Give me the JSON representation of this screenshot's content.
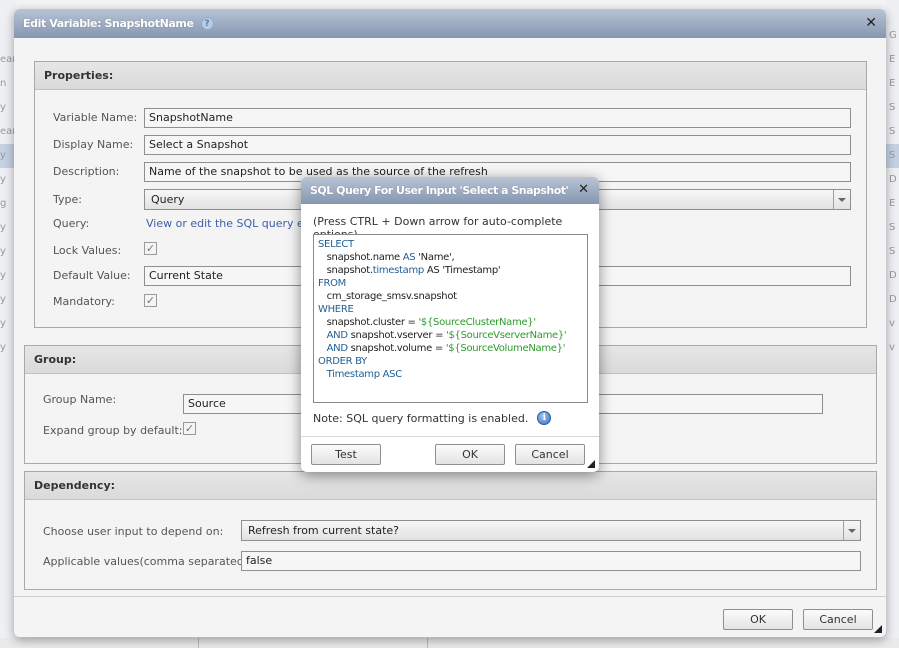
{
  "background": {
    "left_rows": [
      "ean",
      "n",
      "y",
      "ean",
      "y",
      "y",
      "g",
      "y",
      "y",
      "y",
      "y",
      "y",
      "y"
    ],
    "left_selected_index": 4,
    "right_rows": [
      "G",
      "E",
      "E",
      "S",
      "S",
      "S",
      "D",
      "E",
      "S",
      "S",
      "D",
      "D",
      "v",
      "v"
    ],
    "right_selected_index": 5
  },
  "dialog": {
    "title": "Edit Variable: SnapshotName",
    "help_glyph": "?",
    "close_glyph": "✕",
    "properties": {
      "heading": "Properties:",
      "variable_name_label": "Variable Name:",
      "variable_name_value": "SnapshotName",
      "display_name_label": "Display Name:",
      "display_name_value": "Select a Snapshot",
      "description_label": "Description:",
      "description_value": "Name of the snapshot to be used as the source of the refresh",
      "type_label": "Type:",
      "type_value": "Query",
      "query_label": "Query:",
      "query_link": "View or edit the SQL query executed",
      "lock_values_label": "Lock Values:",
      "lock_values_checked": true,
      "default_value_label": "Default Value:",
      "default_value_value": "Current State",
      "mandatory_label": "Mandatory:",
      "mandatory_checked": true
    },
    "group": {
      "heading": "Group:",
      "group_name_label": "Group Name:",
      "group_name_value": "Source",
      "expand_label": "Expand group by default:",
      "expand_checked": true
    },
    "dependency": {
      "heading": "Dependency:",
      "depend_label": "Choose user input to depend on:",
      "depend_value": "Refresh from current state?",
      "applicable_label": "Applicable values(comma separated):",
      "applicable_value": "false"
    },
    "buttons": {
      "ok": "OK",
      "cancel": "Cancel"
    },
    "check_glyph": "✓"
  },
  "sql_dialog": {
    "title": "SQL Query For User Input 'Select a Snapshot'",
    "close_glyph": "✕",
    "hint": "(Press CTRL + Down arrow for auto-complete options)",
    "lines": [
      [
        {
          "t": "SELECT",
          "c": "kw"
        }
      ],
      [
        {
          "t": "   snapshot.name ",
          "c": "id"
        },
        {
          "t": "AS",
          "c": "kw"
        },
        {
          "t": " 'Name',",
          "c": "id"
        }
      ],
      [
        {
          "t": "   snapshot.",
          "c": "id"
        },
        {
          "t": "timestamp",
          "c": "kw"
        },
        {
          "t": " AS ",
          "c": "id"
        },
        {
          "t": "'Timestamp'",
          "c": "id"
        }
      ],
      [
        {
          "t": "FROM",
          "c": "kw"
        }
      ],
      [
        {
          "t": "   cm_storage_smsv.snapshot",
          "c": "id"
        }
      ],
      [
        {
          "t": "WHERE",
          "c": "kw"
        }
      ],
      [
        {
          "t": "   snapshot.cluster = ",
          "c": "id"
        },
        {
          "t": "'${SourceClusterName}'",
          "c": "str"
        }
      ],
      [
        {
          "t": "   ",
          "c": "id"
        },
        {
          "t": "AND",
          "c": "kw"
        },
        {
          "t": " snapshot.vserver = ",
          "c": "id"
        },
        {
          "t": "'${SourceVserverName}'",
          "c": "str"
        }
      ],
      [
        {
          "t": "   ",
          "c": "id"
        },
        {
          "t": "AND",
          "c": "kw"
        },
        {
          "t": " snapshot.volume = ",
          "c": "id"
        },
        {
          "t": "'${SourceVolumeName}'",
          "c": "str"
        }
      ],
      [
        {
          "t": "ORDER BY",
          "c": "kw"
        }
      ],
      [
        {
          "t": "   Timestamp ASC",
          "c": "kw"
        }
      ]
    ],
    "note": "Note: SQL query formatting is enabled.",
    "info_glyph": "i",
    "buttons": {
      "test": "Test",
      "ok": "OK",
      "cancel": "Cancel"
    }
  }
}
